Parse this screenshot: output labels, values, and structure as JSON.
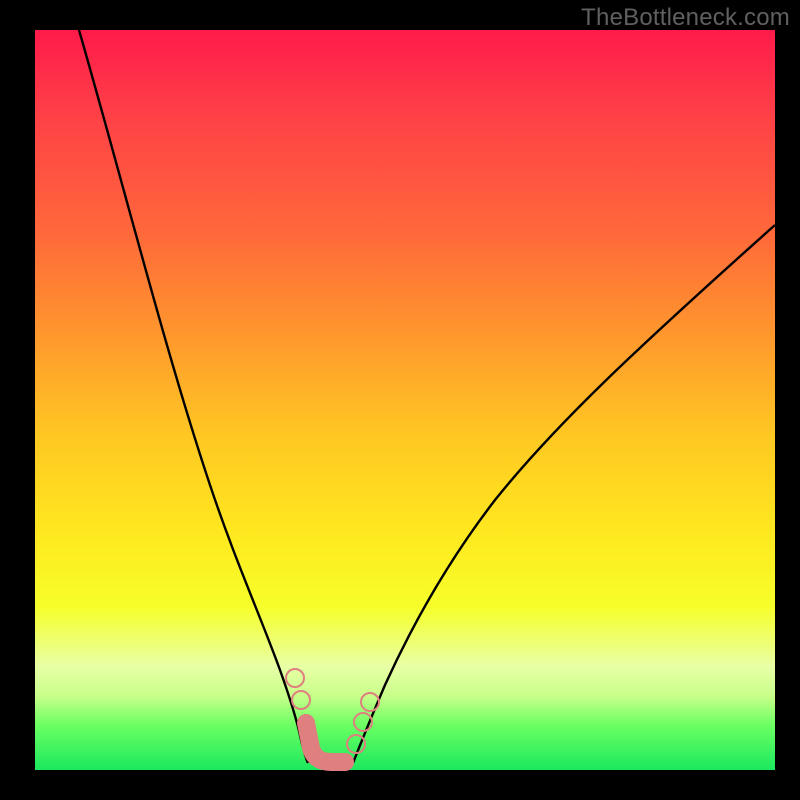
{
  "watermark": "TheBottleneck.com",
  "chart_data": {
    "type": "line",
    "title": "",
    "xlabel": "",
    "ylabel": "",
    "xlim": [
      0,
      100
    ],
    "ylim": [
      0,
      100
    ],
    "note": "No axes, ticks, or numeric labels are rendered; curve coordinates are read off as fraction of plot area (0 = left/top, 100 = right/bottom).",
    "series": [
      {
        "name": "left-descending-curve",
        "color": "#000000",
        "points_xy_percent": [
          [
            6,
            0
          ],
          [
            12,
            22
          ],
          [
            18,
            44
          ],
          [
            23,
            60
          ],
          [
            27,
            72
          ],
          [
            30,
            81
          ],
          [
            32,
            87
          ],
          [
            33.5,
            91
          ],
          [
            34.5,
            95
          ],
          [
            35.5,
            98
          ],
          [
            36.5,
            99
          ]
        ]
      },
      {
        "name": "right-ascending-curve",
        "color": "#000000",
        "points_xy_percent": [
          [
            43,
            99
          ],
          [
            45,
            95
          ],
          [
            47,
            90
          ],
          [
            50,
            83
          ],
          [
            55,
            73
          ],
          [
            62,
            61
          ],
          [
            70,
            50
          ],
          [
            80,
            40
          ],
          [
            90,
            32
          ],
          [
            100,
            26
          ]
        ]
      },
      {
        "name": "trough-marker",
        "color": "#e28080",
        "shape": "rounded-hook",
        "approx_center_xy_percent": [
          39,
          97
        ],
        "description": "thick salmon J-shaped marker at curve minimum"
      }
    ]
  }
}
